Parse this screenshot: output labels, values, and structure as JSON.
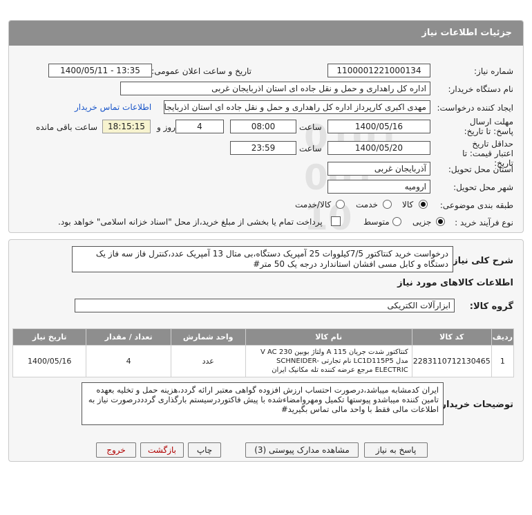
{
  "title": "جزئیات اطلاعات نیاز",
  "labels": {
    "need_number": "شماره نیاز:",
    "announce_datetime": "تاریخ و ساعت اعلان عمومی:",
    "buyer_org": "نام دستگاه خریدار:",
    "requester": "ایجاد کننده درخواست:",
    "reply_deadline": "مهلت ارسال پاسخ: تا تاریخ:",
    "time": "ساعت",
    "days_and": "روز و",
    "remaining": "ساعت باقی مانده",
    "validity": "حداقل تاریخ اعتبار قیمت: تا تاریخ:",
    "delivery_province": "استان محل تحویل:",
    "delivery_city": "شهر محل تحویل:",
    "category": "طبقه بندی موضوعی:",
    "process_type": "نوع فرآیند خرید :",
    "general_desc": "شرح کلی نیاز:",
    "goods_info": "اطلاعات کالاهای مورد نیاز",
    "goods_group": "گروه کالا:",
    "buyer_notes": "توضیحات خریدار:"
  },
  "fields": {
    "need_number": "1100001221000134",
    "announce_datetime": "1400/05/11 - 13:35",
    "buyer_org": "اداره کل راهداری و حمل و نقل جاده ای استان اذربایجان غربی",
    "requester": "مهدی اکبری کارپرداز اداره کل راهداری و حمل و نقل جاده ای استان اذربایجان غ",
    "contact_link": "اطلاعات تماس خریدار",
    "reply_date": "1400/05/16",
    "reply_time": "08:00",
    "days": "4",
    "remaining_time": "18:15:15",
    "validity_date": "1400/05/20",
    "validity_time": "23:59",
    "province": "آذربایجان غربی",
    "city": "ارومیه"
  },
  "category_options": [
    "کالا",
    "خدمت",
    "کالا/خدمت"
  ],
  "process_options": [
    "جزیی",
    "متوسط"
  ],
  "process_note": "پرداخت تمام یا بخشی از مبلغ خرید،از محل \"اسناد خزانه اسلامی\" خواهد بود.",
  "description": "درخواست خرید کنتاکتور 7/5کیلووات 25 آمپریک دستگاه،بی متال 13 آمپریک عدد،کنترل فاز سه فاز یک دستگاه و کابل مسی افشان استاندارد درجه یک 50 متر#",
  "goods_group_value": "ابزارآلات الکتریکی",
  "table": {
    "headers": [
      "ردیف",
      "کد کالا",
      "نام کالا",
      "واحد شمارش",
      "تعداد / مقدار",
      "تاریخ نیاز"
    ],
    "rows": [
      {
        "row": "1",
        "code": "2283110712130465",
        "name": "کنتاکتور شدت جریان A 115 ولتاژ بوبین V AC 230 مدل LC1D115P5 نام تجارتی SCHNEIDER-ELECTRIC مرجع عرضه کننده تله مکانیک ایران",
        "unit": "عدد",
        "qty": "4",
        "date": "1400/05/16"
      }
    ]
  },
  "notes": "ایران کدمشابه میباشد،درصورت احتساب ارزش افزوده گواهی معتبر ارائه گردد،هزینه حمل و تخلیه بعهده تامین کننده میباشدو پیوستها تکمیل ومهروامضاءشده با پیش فاکتوردرسیستم بارگذاری گردددرصورت نیاز به اطلاعات مالی فقط با واحد مالی تماس بگیرید#",
  "buttons": {
    "reply": "پاسخ به نیاز",
    "attachments": "مشاهده مدارک پیوستی (3)",
    "print": "چاپ",
    "back": "بازگشت",
    "exit": "خروج"
  },
  "colors": {
    "title_bar": "#8e8e8e",
    "link": "#1a56c9",
    "exit_text": "#b00000",
    "remaining_bg": "#f7f3cf"
  }
}
